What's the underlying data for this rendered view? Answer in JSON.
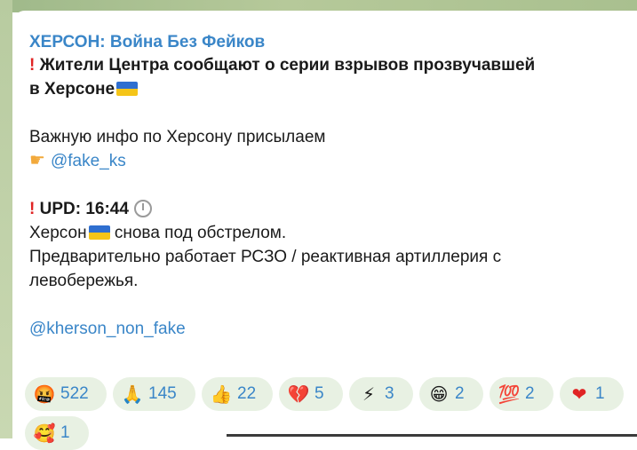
{
  "post": {
    "channel": "ХЕРСОН: Война Без Фейков",
    "headline_1": "Жители Центра сообщают о серии взрывов прозвучавшей",
    "headline_2": "в Херсоне",
    "info_text": "Важную инфо по Херсону присылаем",
    "info_handle": "@fake_ks",
    "upd": "UPD: 16:44",
    "body_1a": "Херсон",
    "body_1b": " снова под обстрелом.",
    "body_2": "Предварительно работает РСЗО / реактивная артиллерия с",
    "body_3": "левобережья.",
    "footer_handle": "@kherson_non_fake"
  },
  "icons": {
    "exclamation": "red-exclamation-icon",
    "flag": "ukraine-flag-icon",
    "pointer": "pointing-hand-icon",
    "stopwatch": "stopwatch-icon"
  },
  "reactions": [
    {
      "emoji": "🤬",
      "count": "522",
      "name": "angry-swearing"
    },
    {
      "emoji": "🙏",
      "count": "145",
      "name": "praying-hands"
    },
    {
      "emoji": "👍",
      "count": "22",
      "name": "thumbs-up"
    },
    {
      "emoji": "💔",
      "count": "5",
      "name": "broken-heart"
    },
    {
      "emoji": "⚡",
      "count": "3",
      "name": "lightning"
    },
    {
      "emoji": "😁",
      "count": "2",
      "name": "grinning-face"
    },
    {
      "emoji": "💯",
      "count": "2",
      "name": "hundred-points"
    },
    {
      "emoji": "❤",
      "count": "1",
      "name": "red-heart"
    },
    {
      "emoji": "🥰",
      "count": "1",
      "name": "smiling-hearts"
    }
  ],
  "colors": {
    "link": "#3a86c8",
    "reaction_bg": "#e8f1e3",
    "exclamation": "#e02424"
  }
}
